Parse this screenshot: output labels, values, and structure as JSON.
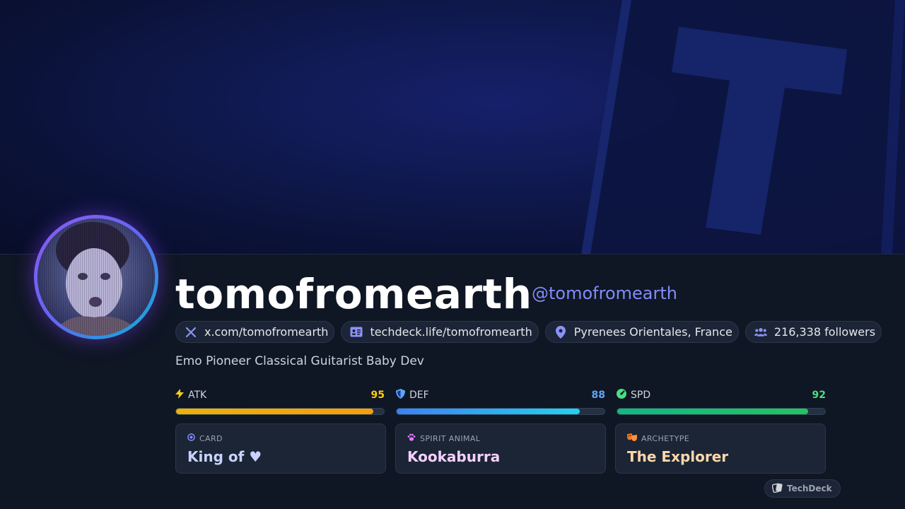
{
  "profile": {
    "display_name": "tomofromearth",
    "handle": "@tomofromearth",
    "bio": "Emo Pioneer Classical Guitarist Baby Dev"
  },
  "chips": [
    {
      "icon": "x-logo-icon",
      "label": "x.com/tomofromearth"
    },
    {
      "icon": "id-card-icon",
      "label": "techdeck.life/tomofromearth"
    },
    {
      "icon": "location-pin-icon",
      "label": "Pyrenees Orientales, France"
    },
    {
      "icon": "users-icon",
      "label": "216,338 followers"
    }
  ],
  "stats": [
    {
      "icon": "lightning-icon",
      "label": "ATK",
      "value": "95",
      "percent": 95,
      "color": "#facc15"
    },
    {
      "icon": "shield-icon",
      "label": "DEF",
      "value": "88",
      "percent": 88,
      "color": "#60a5fa"
    },
    {
      "icon": "gauge-icon",
      "label": "SPD",
      "value": "92",
      "percent": 92,
      "color": "#4ade80"
    }
  ],
  "cards": [
    {
      "icon": "target-icon",
      "caption": "CARD",
      "value": "King of ♥",
      "color": "#c7d2fe"
    },
    {
      "icon": "paw-icon",
      "caption": "SPIRIT ANIMAL",
      "value": "Kookaburra",
      "color": "#f5d0fe"
    },
    {
      "icon": "masks-icon",
      "caption": "ARCHETYPE",
      "value": "The Explorer",
      "color": "#fed7aa"
    }
  ],
  "brand": {
    "icon": "cards-logo-icon",
    "label": "TechDeck"
  },
  "colors": {
    "accent": "#818cf8",
    "background": "#0f1624",
    "atk_bar": "#eab308",
    "def_bar": "#0ea5e9",
    "spd_bar": "#22c55e"
  }
}
